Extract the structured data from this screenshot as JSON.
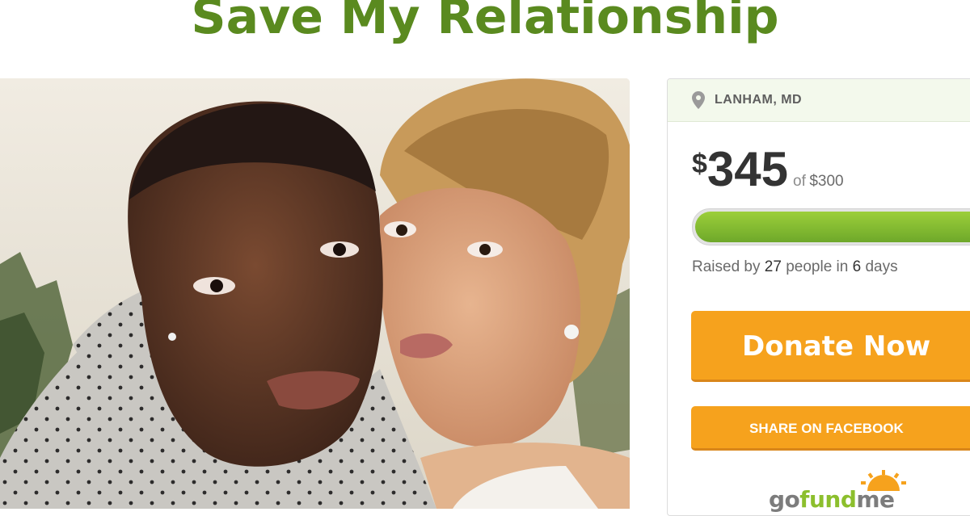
{
  "page": {
    "title": "Save My Relationship"
  },
  "campaign": {
    "location": "LANHAM, MD",
    "currency_symbol": "$",
    "raised_amount": "345",
    "goal_prefix": "of",
    "goal_amount": "$300",
    "progress_fraction": 1.0,
    "raised_by_prefix": "Raised by",
    "donor_count": "27",
    "people_in": "people in",
    "days_count": "6",
    "days_suffix": "days"
  },
  "buttons": {
    "donate_label": "Donate Now",
    "share_label": "SHARE ON FACEBOOK"
  },
  "brand": {
    "logo_part1": "go",
    "logo_part2": "fund",
    "logo_part3": "me",
    "accent_orange": "#f6a21d",
    "accent_green": "#5a8a1f",
    "progress_green": "#7db82e"
  },
  "icons": {
    "location": "map-pin-icon",
    "logo_mark": "sun-burst-icon"
  }
}
